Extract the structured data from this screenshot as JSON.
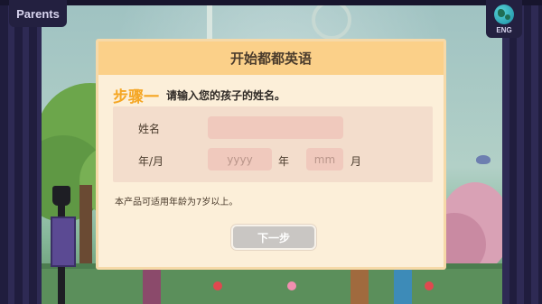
{
  "topbar": {
    "parents_label": "Parents",
    "language_label": "ENG",
    "language_icon": "globe-icon"
  },
  "dialog": {
    "title": "开始都都英语",
    "step_label": "步骤一",
    "step_instruction": "请输入您的孩子的姓名。",
    "name_label": "姓名",
    "name_value": "",
    "year_month_label": "年/月",
    "year_placeholder": "yyyy",
    "year_unit": "年",
    "month_placeholder": "mm",
    "month_unit": "月",
    "age_note": "本产品可适用年龄为7岁以上。",
    "next_label": "下一步"
  },
  "colors": {
    "header": "#fbd089",
    "step_accent": "#f5a623",
    "panel": "#f3ddcc",
    "input": "#f0c9bd",
    "button_disabled": "#c9c6c3",
    "curtain": "#232040"
  }
}
